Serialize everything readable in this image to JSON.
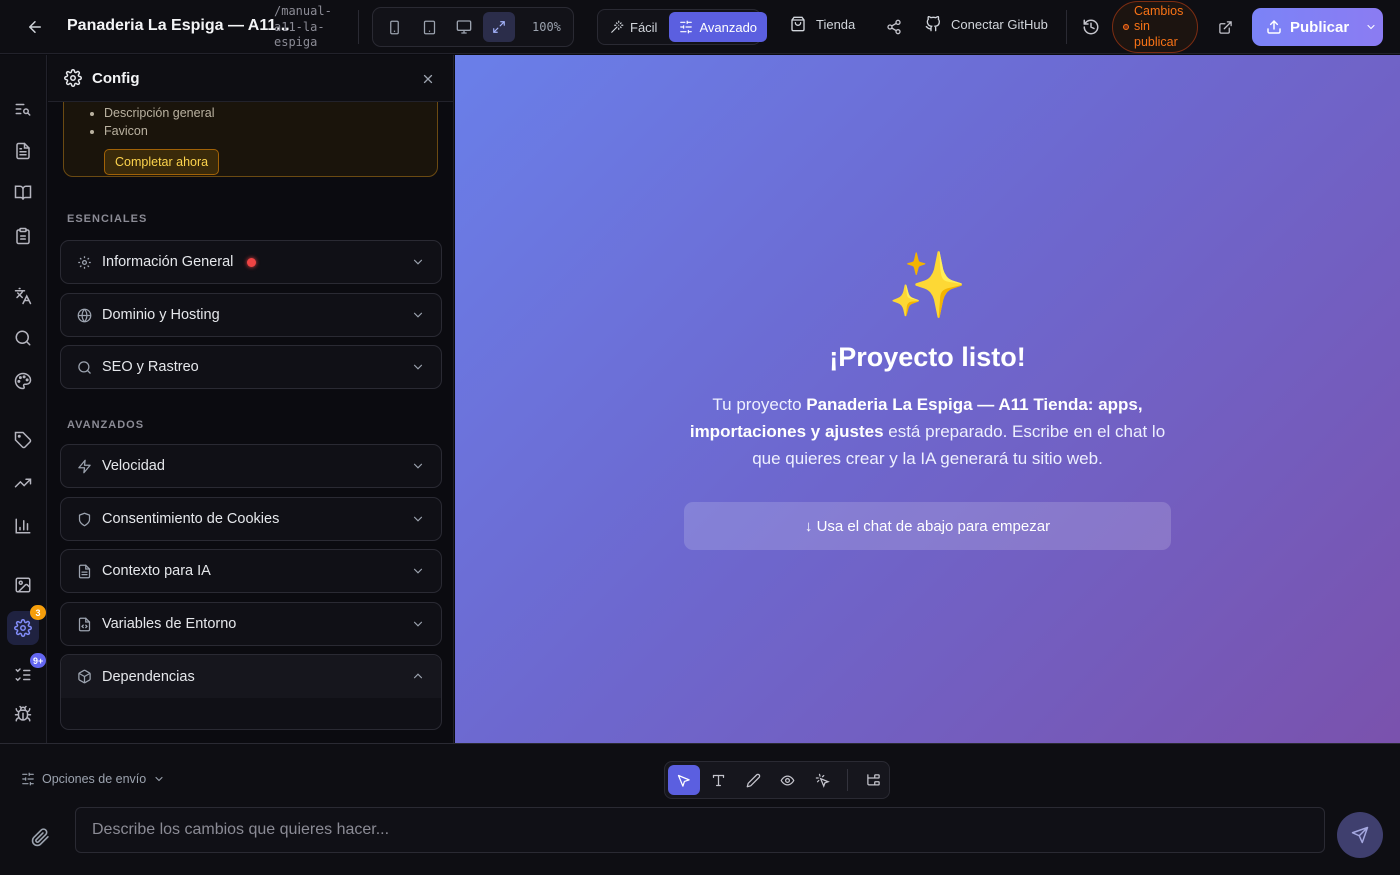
{
  "header": {
    "project_title": "Panaderia La Espiga — A11...",
    "project_path": "/manual-a11-la-espiga",
    "zoom": "100%",
    "modes": {
      "easy": "Fácil",
      "advanced": "Avanzado"
    },
    "store_label": "Tienda",
    "github_label": "Conectar GitHub",
    "unpublished_label": "Cambios sin publicar",
    "publish_label": "Publicar"
  },
  "rail": {
    "settings_badge": "3",
    "tasks_badge": "9+"
  },
  "panel": {
    "title": "Config",
    "warning": {
      "items": [
        "Descripción general",
        "Favicon"
      ],
      "action_label": "Completar ahora"
    },
    "essentials_label": "ESENCIALES",
    "essentials": [
      "Información General",
      "Dominio y Hosting",
      "SEO y Rastreo"
    ],
    "advanced_label": "AVANZADOS",
    "advanced": [
      "Velocidad",
      "Consentimiento de Cookies",
      "Contexto para IA",
      "Variables de Entorno",
      "Dependencias"
    ]
  },
  "preview": {
    "emoji": "✨",
    "title": "¡Proyecto listo!",
    "desc_prefix": "Tu proyecto ",
    "desc_project": "Panaderia La Espiga — A11 Tienda: apps, importaciones y ajustes",
    "desc_suffix": " está preparado. Escribe en el chat lo que quieres crear y la IA generará tu sitio web.",
    "hint": "↓ Usa el chat de abajo para empezar"
  },
  "chat": {
    "send_options_label": "Opciones de envío",
    "input_placeholder": "Describe los cambios que quieres hacer..."
  },
  "colors": {
    "accent": "#5b5fe0",
    "publish": "#7c7cf8",
    "warning": "#f97316",
    "error_dot": "#ef4444"
  }
}
